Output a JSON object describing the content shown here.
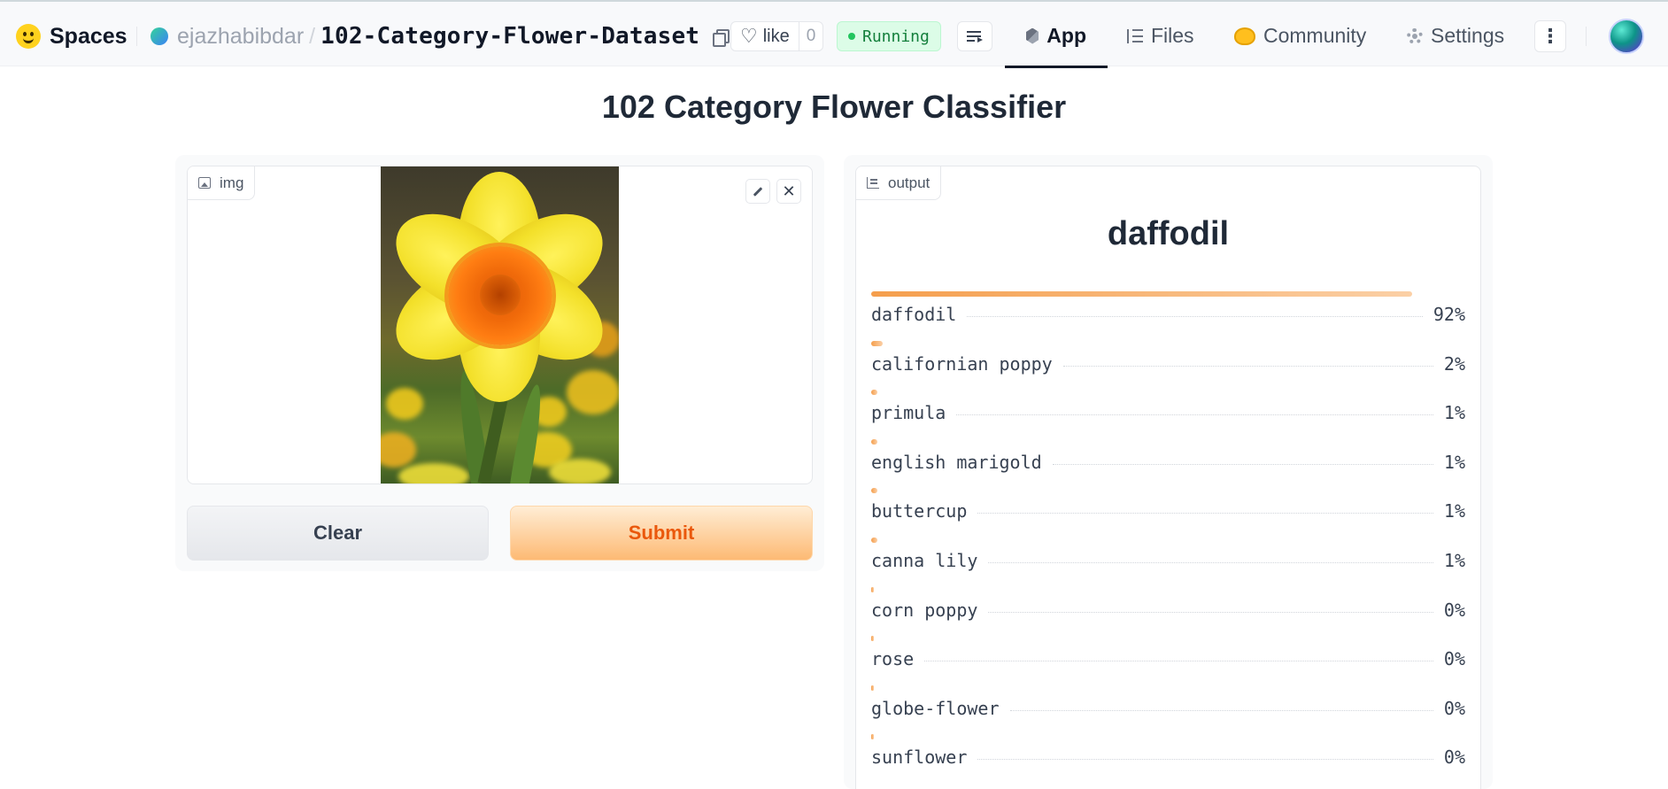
{
  "header": {
    "brand": "Spaces",
    "owner": "ejazhabibdar",
    "slash": "/",
    "repo_name": "102-Category-Flower-Dataset",
    "like_label": "like",
    "like_count": "0",
    "status": "Running",
    "tabs": [
      {
        "label": "App",
        "icon": "cube-icon",
        "active": true
      },
      {
        "label": "Files",
        "icon": "files-icon",
        "active": false
      },
      {
        "label": "Community",
        "icon": "community-icon",
        "active": false
      },
      {
        "label": "Settings",
        "icon": "gear-icon",
        "active": false
      }
    ],
    "more_label": "⋮"
  },
  "main": {
    "title": "102 Category Flower Classifier",
    "input": {
      "label": "img",
      "image_subject": "yellow daffodil with orange trumpet"
    },
    "buttons": {
      "clear": "Clear",
      "submit": "Submit"
    },
    "output": {
      "label": "output",
      "prediction": "daffodil",
      "confidences": [
        {
          "label": "daffodil",
          "value": "92%",
          "fraction": 0.92
        },
        {
          "label": "californian poppy",
          "value": "2%",
          "fraction": 0.02
        },
        {
          "label": "primula",
          "value": "1%",
          "fraction": 0.01
        },
        {
          "label": "english marigold",
          "value": "1%",
          "fraction": 0.01
        },
        {
          "label": "buttercup",
          "value": "1%",
          "fraction": 0.01
        },
        {
          "label": "canna lily",
          "value": "1%",
          "fraction": 0.01
        },
        {
          "label": "corn poppy",
          "value": "0%",
          "fraction": 0.004
        },
        {
          "label": "rose",
          "value": "0%",
          "fraction": 0.004
        },
        {
          "label": "globe-flower",
          "value": "0%",
          "fraction": 0.003
        },
        {
          "label": "sunflower",
          "value": "0%",
          "fraction": 0.003
        }
      ]
    }
  },
  "colors": {
    "accent": "#ea580c",
    "running_green": "#15803d",
    "bar_start": "#f59e4c",
    "bar_end": "#fbd0a6"
  }
}
